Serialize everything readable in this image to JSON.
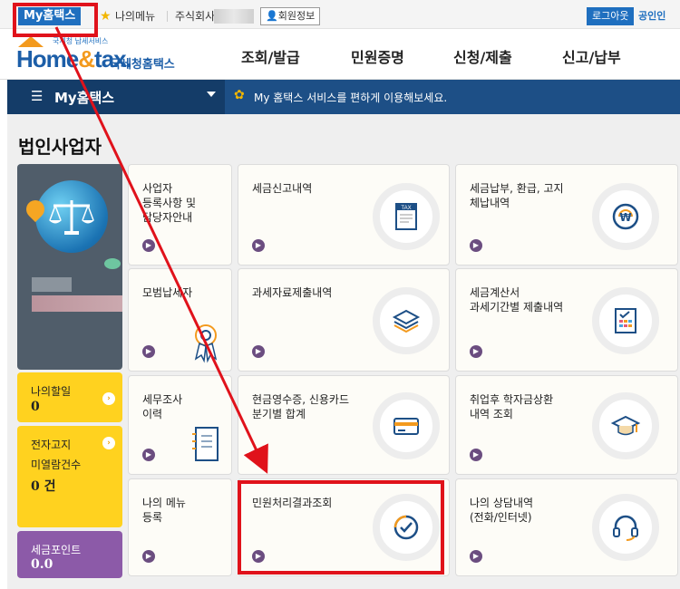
{
  "topbar": {
    "myhome": "My홈택스",
    "mymenu": "나의메뉴",
    "corp": "주식회사",
    "member": "회원정보",
    "logout": "로그아웃",
    "cert": "공인인"
  },
  "logo": {
    "tagline": "국세청 납세서비스",
    "brand_main": "Home",
    "brand_amp": "&",
    "brand_rest": "tax.",
    "brand_kr": "국세청홈택스"
  },
  "gnb": [
    "조회/발급",
    "민원증명",
    "신청/제출",
    "신고/납부"
  ],
  "subbar": {
    "title": "My홈택스",
    "message": "My 홈택스 서비스를 편하게 이용해보세요."
  },
  "section_title": "법인사업자",
  "side": {
    "todo_label": "나의할일",
    "todo_value": "0",
    "bill_label_1": "전자고지",
    "bill_label_2": "미열람건수",
    "bill_value": "0 건",
    "points_label": "세금포인트",
    "points_value": "0.0"
  },
  "tiles": [
    {
      "label": "사업자\n등록사항 및\n담당자안내",
      "icon": "person-icon"
    },
    {
      "label": "세금신고내역",
      "icon": "tax-document-icon"
    },
    {
      "label": "세금납부, 환급, 고지\n체납내역",
      "icon": "won-coin-icon"
    },
    {
      "label": "모범납세자",
      "icon": "award-ribbon-icon"
    },
    {
      "label": "과세자료제출내역",
      "icon": "stacked-layers-icon"
    },
    {
      "label": "세금계산서\n과세기간별 제출내역",
      "icon": "invoice-checklist-icon"
    },
    {
      "label": "세무조사\n이력",
      "icon": "notebook-icon"
    },
    {
      "label": "현금영수증, 신용카드\n분기별 합계",
      "icon": "card-icon"
    },
    {
      "label": "취업후 학자금상환\n내역 조회",
      "icon": "graduation-cap-icon"
    },
    {
      "label": "나의 메뉴\n등록",
      "icon": "none"
    },
    {
      "label": "민원처리결과조회",
      "icon": "check-circle-icon"
    },
    {
      "label": "나의 상담내역\n(전화/인터넷)",
      "icon": "headset-icon"
    }
  ],
  "colors": {
    "accent_blue": "#1f6fbf",
    "navy": "#1d4f86",
    "highlight_red": "#e0121b",
    "yellow": "#ffd21f",
    "purple": "#8c5aa8"
  }
}
